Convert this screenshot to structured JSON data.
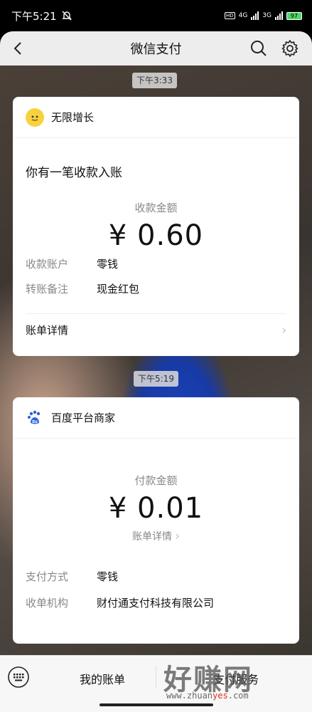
{
  "status": {
    "time": "下午5:21",
    "net1": "4G",
    "net2": "3G",
    "hd": "HD",
    "battery": "97"
  },
  "header": {
    "title": "微信支付"
  },
  "messages": [
    {
      "timestamp": "下午3:33",
      "merchant": "无限增长",
      "notice": "你有一笔收款入账",
      "amount_label": "收款金额",
      "amount": "¥ 0.60",
      "rows": [
        {
          "key": "收款账户",
          "value": "零钱"
        },
        {
          "key": "转账备注",
          "value": "现金红包"
        }
      ],
      "detail": "账单详情"
    },
    {
      "timestamp": "下午5:19",
      "merchant": "百度平台商家",
      "amount_label": "付款金额",
      "amount": "¥ 0.01",
      "detail_link": "账单详情",
      "rows": [
        {
          "key": "支付方式",
          "value": "零钱"
        },
        {
          "key": "收单机构",
          "value": "财付通支付科技有限公司"
        }
      ]
    }
  ],
  "bottom": {
    "my_bills": "我的账单",
    "second_item": "支付服务"
  },
  "watermark": {
    "text": "好赚网",
    "url_a": "www.zhuan",
    "url_b": "yes",
    "url_c": ".com"
  }
}
